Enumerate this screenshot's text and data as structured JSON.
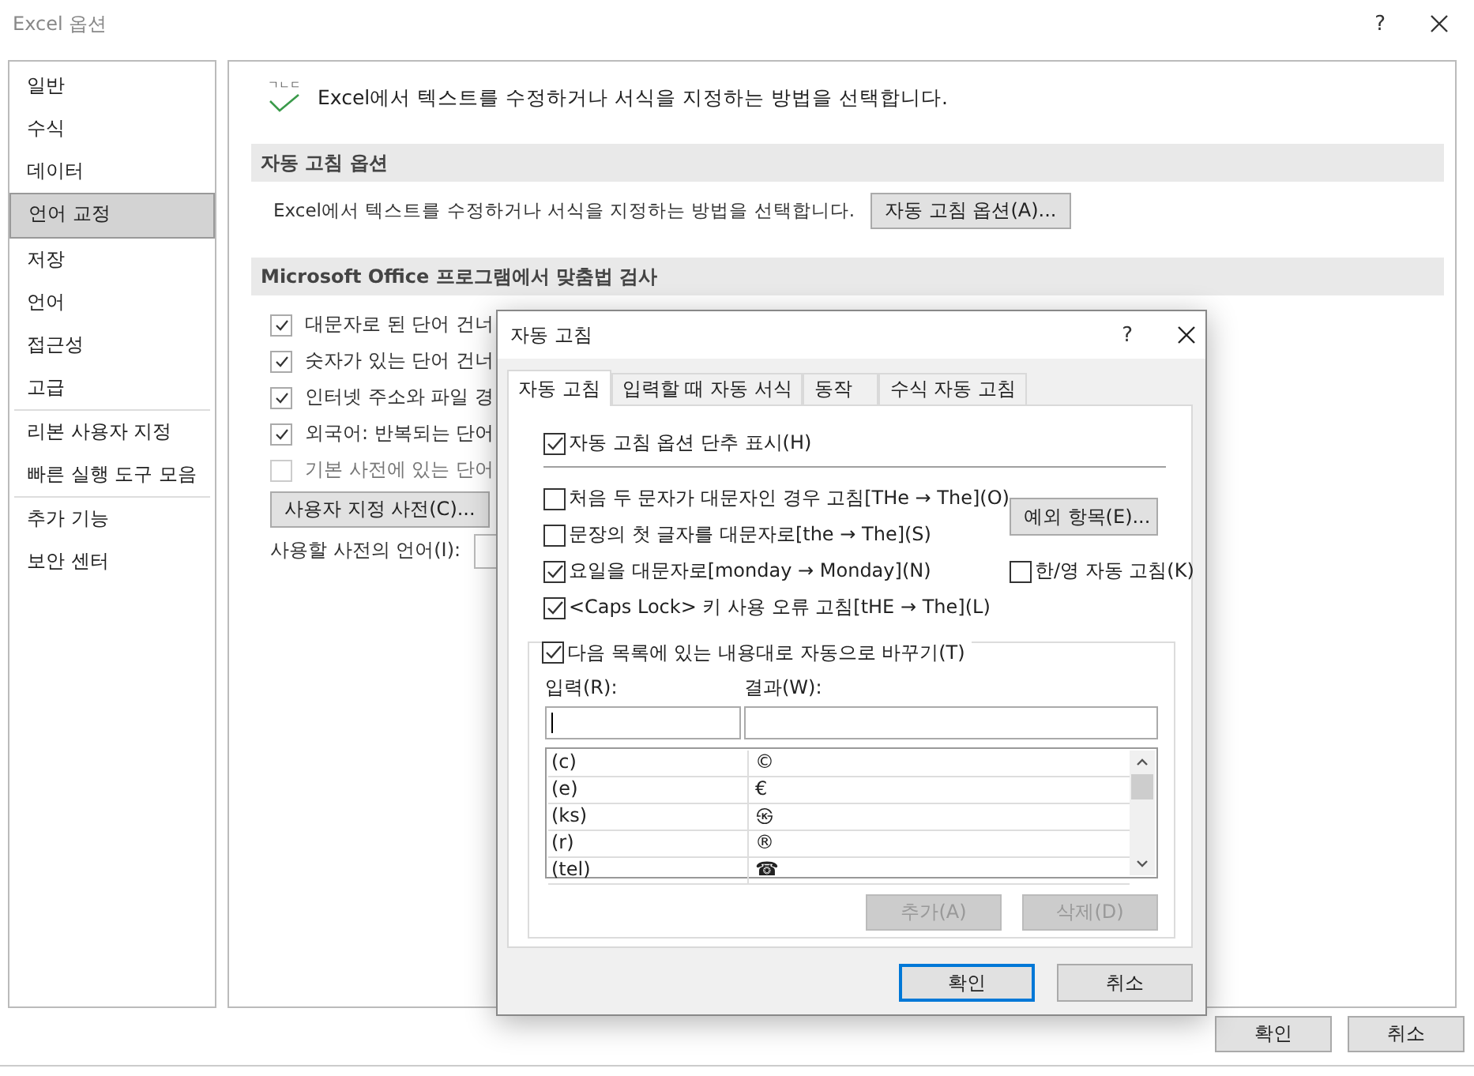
{
  "window": {
    "title": "Excel 옵션",
    "help": "?"
  },
  "sidebar": {
    "groups": [
      [
        {
          "label": "일반",
          "selected": false
        },
        {
          "label": "수식",
          "selected": false
        },
        {
          "label": "데이터",
          "selected": false
        },
        {
          "label": "언어 교정",
          "selected": true
        },
        {
          "label": "저장",
          "selected": false
        },
        {
          "label": "언어",
          "selected": false
        },
        {
          "label": "접근성",
          "selected": false
        },
        {
          "label": "고급",
          "selected": false
        }
      ],
      [
        {
          "label": "리본 사용자 지정",
          "selected": false
        },
        {
          "label": "빠른 실행 도구 모음",
          "selected": false
        }
      ],
      [
        {
          "label": "추가 기능",
          "selected": false
        },
        {
          "label": "보안 센터",
          "selected": false
        }
      ]
    ]
  },
  "header": {
    "icon_text": "ㄱㄴㄷ",
    "text": "Excel에서 텍스트를 수정하거나 서식을 지정하는 방법을 선택합니다."
  },
  "autocorrect_section": {
    "title": "자동 고침 옵션",
    "description": "Excel에서 텍스트를 수정하거나 서식을 지정하는 방법을 선택합니다.",
    "button": "자동 고침 옵션(A)..."
  },
  "spelling_section": {
    "title": "Microsoft Office 프로그램에서 맞춤법 검사",
    "options": [
      {
        "label": "대문자로 된 단어 건너",
        "checked": true,
        "disabled": false
      },
      {
        "label": "숫자가 있는 단어 건너",
        "checked": true,
        "disabled": false
      },
      {
        "label": "인터넷 주소와 파일 경",
        "checked": true,
        "disabled": false
      },
      {
        "label": "외국어: 반복되는 단어",
        "checked": true,
        "disabled": false
      },
      {
        "label": "기본 사전에 있는 단어",
        "checked": false,
        "disabled": true
      }
    ],
    "dictionary_button": "사용자 지정 사전(C)...",
    "language_label": "사용할 사전의 언어(I):"
  },
  "footer_buttons": [
    "확인",
    "취소"
  ],
  "dialog": {
    "title": "자동 고침",
    "help": "?",
    "tabs": [
      {
        "label": "자동 고침",
        "selected": true
      },
      {
        "label": "입력할 때 자동 서식",
        "selected": false
      },
      {
        "label": "동작",
        "selected": false
      },
      {
        "label": "수식 자동 고침",
        "selected": false
      }
    ],
    "show_buttons": {
      "label": "자동 고침 옵션 단추 표시(H)",
      "checked": true
    },
    "rules": [
      {
        "label": "처음 두 문자가 대문자인 경우 고침[THe → The](O)",
        "checked": false
      },
      {
        "label": "문장의 첫 글자를 대문자로[the → The](S)",
        "checked": false
      },
      {
        "label": "요일을 대문자로[monday → Monday](N)",
        "checked": true
      },
      {
        "label": "<Caps Lock> 키 사용 오류 고침[tHE → The](L)",
        "checked": true
      }
    ],
    "exceptions_button": "예외 항목(E)...",
    "hanyoung": {
      "label": "한/영 자동 고침(K)",
      "checked": false
    },
    "replace": {
      "label": "다음 목록에 있는 내용대로 자동으로 바꾸기(T)",
      "checked": true,
      "input_label": "입력(R):",
      "result_label": "결과(W):",
      "entries": [
        {
          "from": "(c)",
          "to": "©"
        },
        {
          "from": "(e)",
          "to": "€"
        },
        {
          "from": "(ks)",
          "to": "㉿"
        },
        {
          "from": "(r)",
          "to": "®"
        },
        {
          "from": "(tel)",
          "to": "☎"
        }
      ],
      "add_button": {
        "label": "추가(A)",
        "disabled": true
      },
      "delete_button": {
        "label": "삭제(D)",
        "disabled": true
      }
    },
    "buttons": [
      {
        "label": "확인",
        "default": true
      },
      {
        "label": "취소",
        "default": false
      }
    ]
  }
}
